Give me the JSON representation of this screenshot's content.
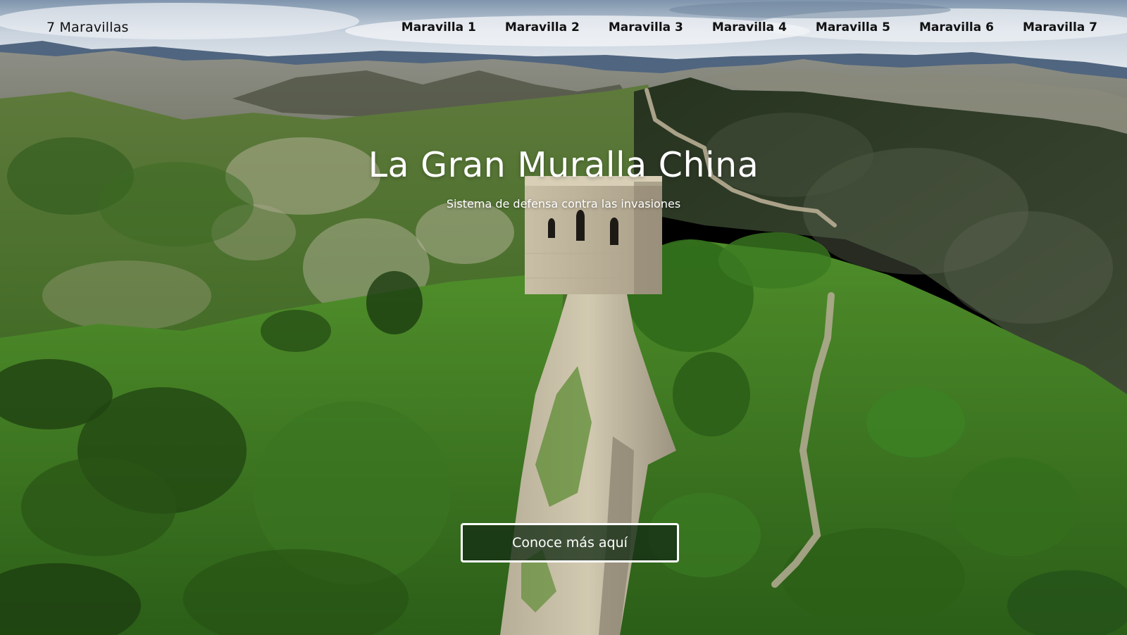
{
  "navbar": {
    "brand": "7 Maravillas",
    "links": [
      {
        "label": "Maravilla 1"
      },
      {
        "label": "Maravilla 2"
      },
      {
        "label": "Maravilla 3"
      },
      {
        "label": "Maravilla 4"
      },
      {
        "label": "Maravilla 5"
      },
      {
        "label": "Maravilla 6"
      },
      {
        "label": "Maravilla 7"
      }
    ]
  },
  "hero": {
    "title": "La Gran Muralla China",
    "subtitle": "Sistema de defensa contra las invasiones",
    "cta_label": "Conoce más aquí"
  },
  "colors": {
    "nav_text": "#111111",
    "hero_text": "#ffffff",
    "button_border": "#ffffff",
    "button_fill": "#142d14"
  }
}
